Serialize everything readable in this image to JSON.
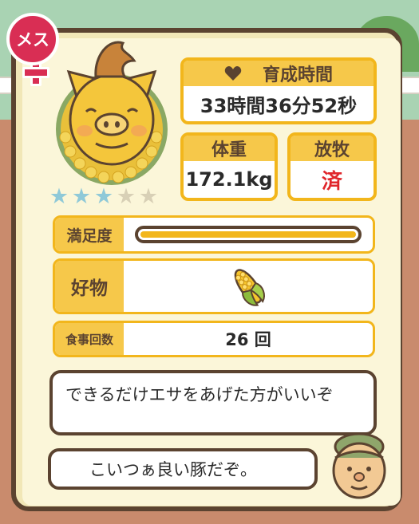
{
  "gender": {
    "label": "メス",
    "icon": "female-symbol-icon"
  },
  "pig": {
    "rating": 3,
    "rating_max": 5,
    "star_icon": "star-icon"
  },
  "growth_time": {
    "label": "育成時間",
    "icon": "heart-icon",
    "value": "33時間36分52秒"
  },
  "weight": {
    "label": "体重",
    "value": "172.1kg"
  },
  "grazing": {
    "label": "放牧",
    "value": "済"
  },
  "satisfaction": {
    "label": "満足度",
    "level": 1.0
  },
  "favorite": {
    "label": "好物",
    "item_icon": "corn-icon"
  },
  "meals": {
    "label": "食事回数",
    "value": "26 回"
  },
  "messages": {
    "tip": "できるだけエサをあげた方がいいぞ",
    "comment": "こいつぁ良い豚だぞ。"
  },
  "colors": {
    "accent": "#f2b61c",
    "header_bg": "#f6c84a",
    "brown": "#5b4330",
    "grazing_value": "#e0262b",
    "female": "#d92e54"
  }
}
